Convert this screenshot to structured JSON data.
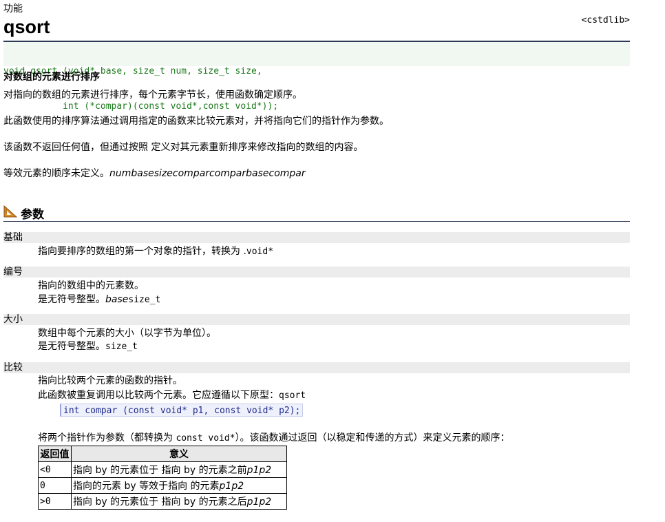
{
  "header": {
    "kicker": "功能",
    "title": "qsort",
    "library": "<cstdlib>"
  },
  "prototype": {
    "line1": "void qsort (void* base, size_t num, size_t size,",
    "line2": "           int (*compar)(const void*,const void*));"
  },
  "description": {
    "short": "对数组的元素进行排序",
    "p1": "对指向的数组的元素进行排序，每个元素字节长，使用函数确定顺序。",
    "p2": "此函数使用的排序算法通过调用指定的函数来比较元素对，并将指向它们的指针作为参数。",
    "p3": "该函数不返回任何值，但通过按照 定义对其元素重新排序来修改指向的数组的内容。",
    "p4_text": "等效元素的顺序未定义。",
    "p4_italic": "numbasesizecomparcomparbasecompar"
  },
  "params_section": {
    "icon": "ruler-triangle-icon",
    "label": "参数"
  },
  "params": {
    "base": {
      "name": "基础",
      "line1_text": "指向要排序的数组的第一个对象的指针，转换为 .",
      "line1_code": "void*"
    },
    "num": {
      "name": "编号",
      "line1": "指向的数组中的元素数。",
      "line2_text": "是无符号整型。",
      "line2_italic": "base",
      "line2_code": "size_t"
    },
    "size": {
      "name": "大小",
      "line1": "数组中每个元素的大小（以字节为单位）。",
      "line2_text": "是无符号整型。",
      "line2_code": "size_t"
    },
    "compar": {
      "name": "比较",
      "line1": "指向比较两个元素的函数的指针。",
      "line2_text": "此函数被重复调用以比较两个元素。它应遵循以下原型：",
      "line2_code": "qsort",
      "code_example": "int compar (const void* p1, const void* p2);",
      "line3_text_a": "将两个指针作为参数（都转换为 ",
      "line3_code": "const void*",
      "line3_text_b": "）。该函数通过返回（以稳定和传递的方式）来定义元素的顺序："
    }
  },
  "return_table": {
    "headers": [
      "返回值",
      "意义"
    ],
    "rows": [
      {
        "value": "<0",
        "meaning": "指向 by 的元素位于 指向 by 的元素之前",
        "meaning_italic": "p1p2"
      },
      {
        "value": "0",
        "meaning": "指向的元素 by 等效于指向 的元素",
        "meaning_italic": "p1p2"
      },
      {
        "value": ">0",
        "meaning": "指向 by 的元素位于 指向 by 的元素之后",
        "meaning_italic": "p1p2"
      }
    ]
  },
  "colors": {
    "rule": "#2f3a57",
    "prototype_text": "#1b7a1b",
    "prototype_bg": "#f1f7f1",
    "param_header_bg": "#ececec",
    "code_box_bg": "#eef0fb"
  }
}
